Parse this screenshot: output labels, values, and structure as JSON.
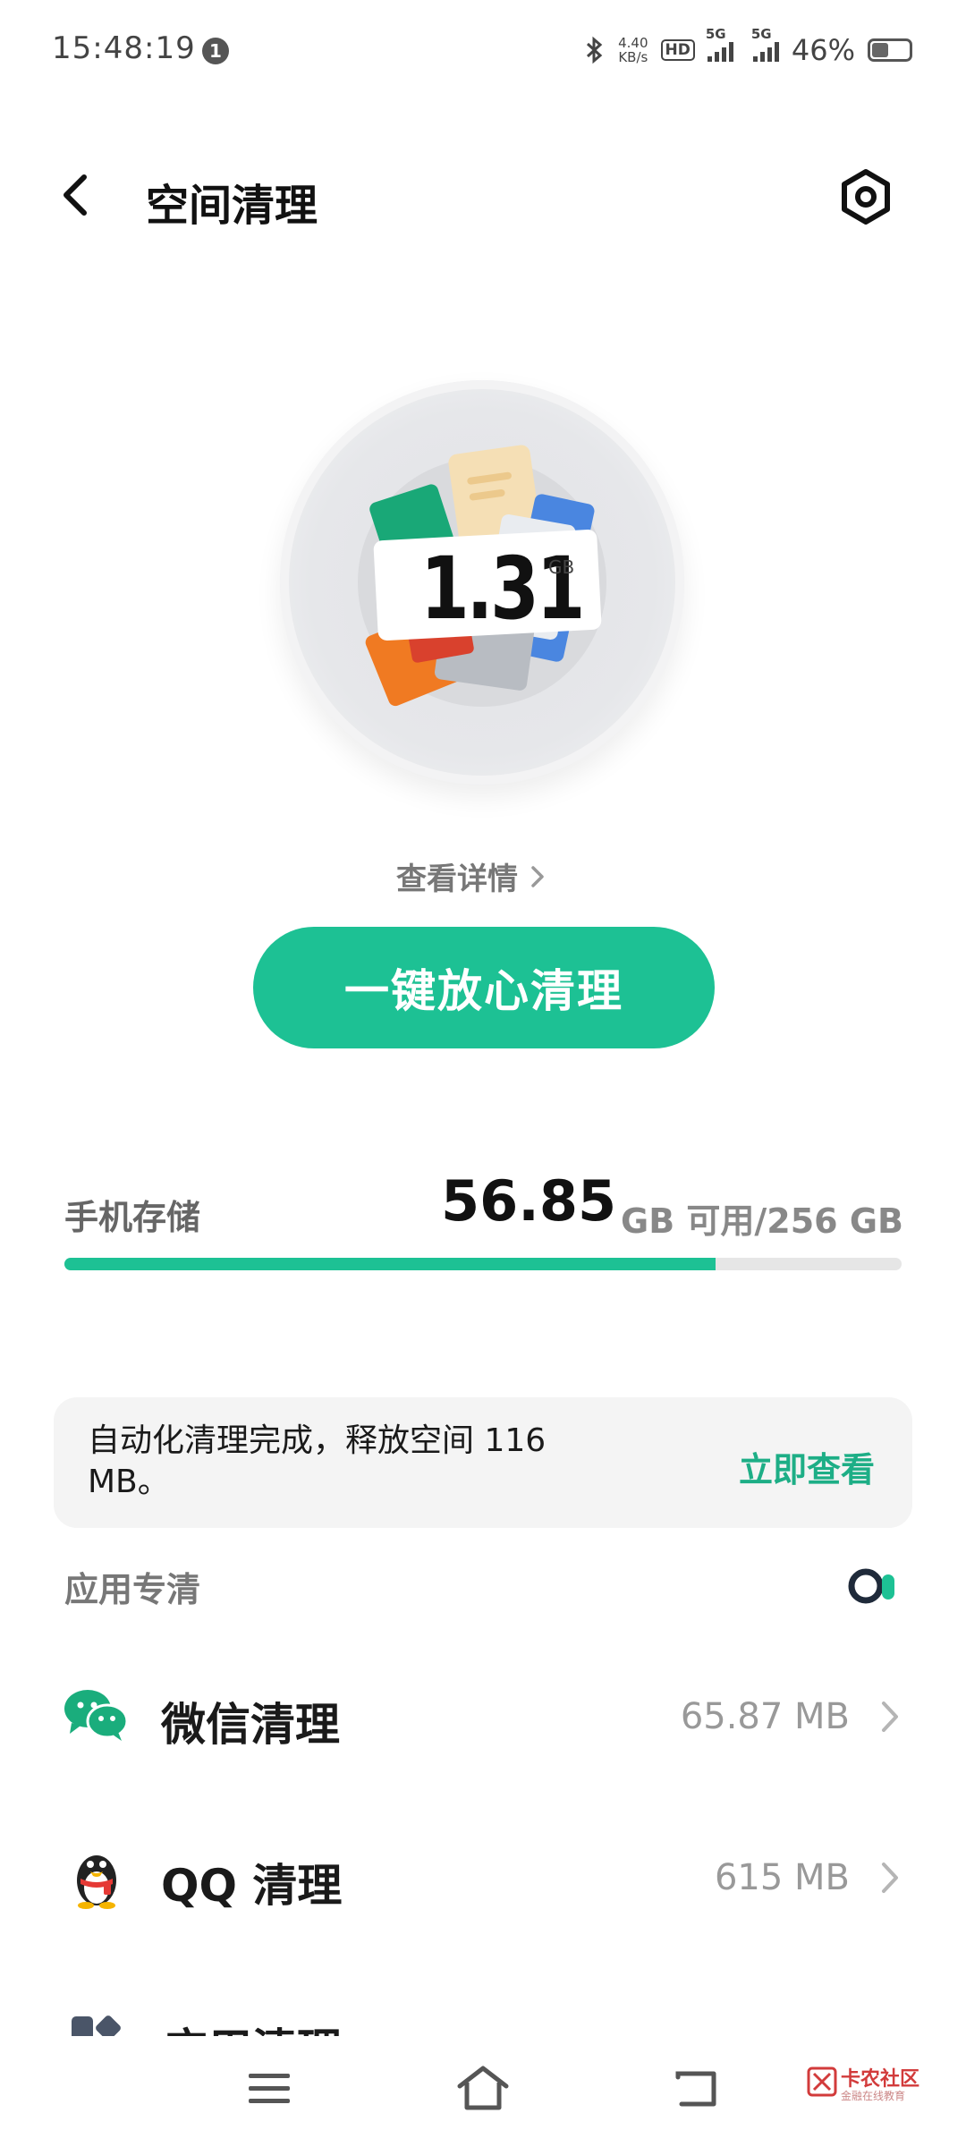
{
  "status_bar": {
    "time": "15:48:19",
    "notification_count": "1",
    "net_speed_value": "4.40",
    "net_speed_unit": "KB/s",
    "hd_label": "HD",
    "sim1_tag": "5G",
    "sim2_tag": "5G",
    "battery": "46%",
    "battery_level_pct": 46
  },
  "header": {
    "title": "空间清理"
  },
  "junk": {
    "size_value": "1.31",
    "size_unit": "GB",
    "view_details": "查看详情",
    "clean_button": "一键放心清理"
  },
  "storage": {
    "label": "手机存储",
    "available_value": "56.85",
    "available_rest": "GB 可用/256 GB",
    "used_fraction": 0.778
  },
  "notice": {
    "text": "自动化清理完成，释放空间 116 MB。",
    "link": "立即查看"
  },
  "app_clean": {
    "section_title": "应用专清",
    "items": [
      {
        "label": "微信清理",
        "size": "65.87 MB",
        "icon": "wechat-icon"
      },
      {
        "label": "QQ 清理",
        "size": "615 MB",
        "icon": "qq-icon"
      },
      {
        "label": "应用清理",
        "size": "",
        "icon": "app-icon"
      }
    ]
  },
  "watermark": {
    "title": "卡农社区",
    "subtitle": "金融在线教育"
  },
  "colors": {
    "accent": "#1dc194",
    "link": "#1dae86"
  }
}
